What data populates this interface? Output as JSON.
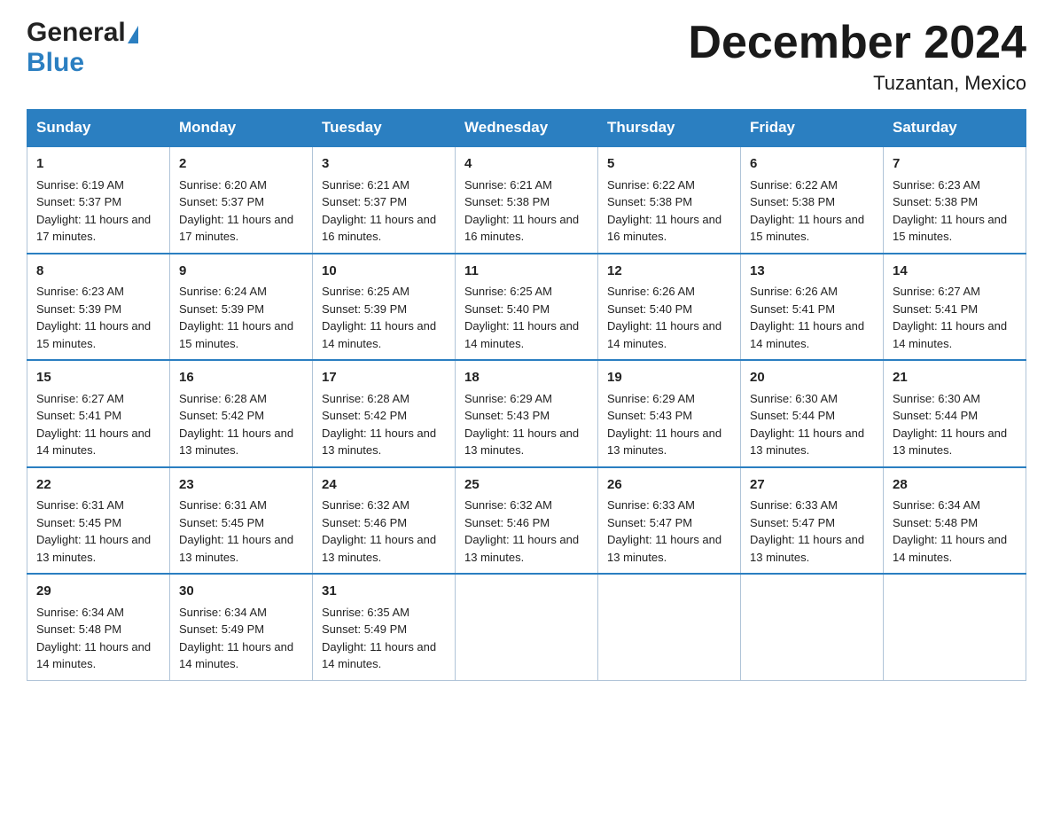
{
  "header": {
    "month_title": "December 2024",
    "location": "Tuzantan, Mexico",
    "logo_general": "General",
    "logo_blue": "Blue"
  },
  "days_of_week": [
    "Sunday",
    "Monday",
    "Tuesday",
    "Wednesday",
    "Thursday",
    "Friday",
    "Saturday"
  ],
  "weeks": [
    [
      {
        "day": "1",
        "sunrise": "6:19 AM",
        "sunset": "5:37 PM",
        "daylight": "11 hours and 17 minutes."
      },
      {
        "day": "2",
        "sunrise": "6:20 AM",
        "sunset": "5:37 PM",
        "daylight": "11 hours and 17 minutes."
      },
      {
        "day": "3",
        "sunrise": "6:21 AM",
        "sunset": "5:37 PM",
        "daylight": "11 hours and 16 minutes."
      },
      {
        "day": "4",
        "sunrise": "6:21 AM",
        "sunset": "5:38 PM",
        "daylight": "11 hours and 16 minutes."
      },
      {
        "day": "5",
        "sunrise": "6:22 AM",
        "sunset": "5:38 PM",
        "daylight": "11 hours and 16 minutes."
      },
      {
        "day": "6",
        "sunrise": "6:22 AM",
        "sunset": "5:38 PM",
        "daylight": "11 hours and 15 minutes."
      },
      {
        "day": "7",
        "sunrise": "6:23 AM",
        "sunset": "5:38 PM",
        "daylight": "11 hours and 15 minutes."
      }
    ],
    [
      {
        "day": "8",
        "sunrise": "6:23 AM",
        "sunset": "5:39 PM",
        "daylight": "11 hours and 15 minutes."
      },
      {
        "day": "9",
        "sunrise": "6:24 AM",
        "sunset": "5:39 PM",
        "daylight": "11 hours and 15 minutes."
      },
      {
        "day": "10",
        "sunrise": "6:25 AM",
        "sunset": "5:39 PM",
        "daylight": "11 hours and 14 minutes."
      },
      {
        "day": "11",
        "sunrise": "6:25 AM",
        "sunset": "5:40 PM",
        "daylight": "11 hours and 14 minutes."
      },
      {
        "day": "12",
        "sunrise": "6:26 AM",
        "sunset": "5:40 PM",
        "daylight": "11 hours and 14 minutes."
      },
      {
        "day": "13",
        "sunrise": "6:26 AM",
        "sunset": "5:41 PM",
        "daylight": "11 hours and 14 minutes."
      },
      {
        "day": "14",
        "sunrise": "6:27 AM",
        "sunset": "5:41 PM",
        "daylight": "11 hours and 14 minutes."
      }
    ],
    [
      {
        "day": "15",
        "sunrise": "6:27 AM",
        "sunset": "5:41 PM",
        "daylight": "11 hours and 14 minutes."
      },
      {
        "day": "16",
        "sunrise": "6:28 AM",
        "sunset": "5:42 PM",
        "daylight": "11 hours and 13 minutes."
      },
      {
        "day": "17",
        "sunrise": "6:28 AM",
        "sunset": "5:42 PM",
        "daylight": "11 hours and 13 minutes."
      },
      {
        "day": "18",
        "sunrise": "6:29 AM",
        "sunset": "5:43 PM",
        "daylight": "11 hours and 13 minutes."
      },
      {
        "day": "19",
        "sunrise": "6:29 AM",
        "sunset": "5:43 PM",
        "daylight": "11 hours and 13 minutes."
      },
      {
        "day": "20",
        "sunrise": "6:30 AM",
        "sunset": "5:44 PM",
        "daylight": "11 hours and 13 minutes."
      },
      {
        "day": "21",
        "sunrise": "6:30 AM",
        "sunset": "5:44 PM",
        "daylight": "11 hours and 13 minutes."
      }
    ],
    [
      {
        "day": "22",
        "sunrise": "6:31 AM",
        "sunset": "5:45 PM",
        "daylight": "11 hours and 13 minutes."
      },
      {
        "day": "23",
        "sunrise": "6:31 AM",
        "sunset": "5:45 PM",
        "daylight": "11 hours and 13 minutes."
      },
      {
        "day": "24",
        "sunrise": "6:32 AM",
        "sunset": "5:46 PM",
        "daylight": "11 hours and 13 minutes."
      },
      {
        "day": "25",
        "sunrise": "6:32 AM",
        "sunset": "5:46 PM",
        "daylight": "11 hours and 13 minutes."
      },
      {
        "day": "26",
        "sunrise": "6:33 AM",
        "sunset": "5:47 PM",
        "daylight": "11 hours and 13 minutes."
      },
      {
        "day": "27",
        "sunrise": "6:33 AM",
        "sunset": "5:47 PM",
        "daylight": "11 hours and 13 minutes."
      },
      {
        "day": "28",
        "sunrise": "6:34 AM",
        "sunset": "5:48 PM",
        "daylight": "11 hours and 14 minutes."
      }
    ],
    [
      {
        "day": "29",
        "sunrise": "6:34 AM",
        "sunset": "5:48 PM",
        "daylight": "11 hours and 14 minutes."
      },
      {
        "day": "30",
        "sunrise": "6:34 AM",
        "sunset": "5:49 PM",
        "daylight": "11 hours and 14 minutes."
      },
      {
        "day": "31",
        "sunrise": "6:35 AM",
        "sunset": "5:49 PM",
        "daylight": "11 hours and 14 minutes."
      },
      null,
      null,
      null,
      null
    ]
  ],
  "labels": {
    "sunrise": "Sunrise:",
    "sunset": "Sunset:",
    "daylight": "Daylight:"
  }
}
